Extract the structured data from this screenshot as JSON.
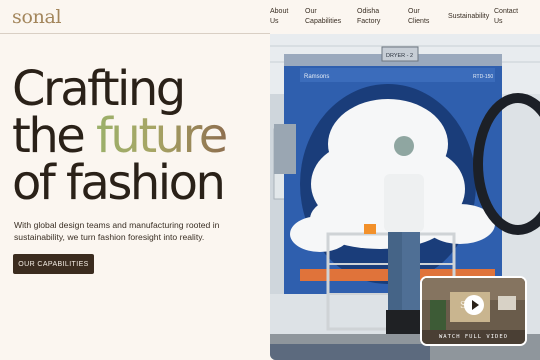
{
  "brand": {
    "logo_text": "sonal"
  },
  "nav": {
    "items": [
      {
        "line1": "About",
        "line2": "Us"
      },
      {
        "line1": "Our",
        "line2": "Capabilities"
      },
      {
        "line1": "Odisha",
        "line2": "Factory"
      },
      {
        "line1": "Our",
        "line2": "Clients"
      },
      {
        "line1": "Sustainability",
        "line2": ""
      },
      {
        "line1": "Contact",
        "line2": "Us"
      }
    ]
  },
  "hero": {
    "headline": {
      "line1": "Crafting",
      "line2_prefix": "the ",
      "line2_accent": "future",
      "line3": "of fashion"
    },
    "subtext": "With global design teams and manufacturing rooted in sustainability, we turn fashion foresight into reality.",
    "cta_label": "OUR CAPABILITIES"
  },
  "photo": {
    "machine_badge": "DRYER - 2",
    "machine_brand": "Ramsons",
    "machine_model": "RTD-150"
  },
  "video": {
    "label": "WATCH FULL VIDEO",
    "thumb_sign": "SA"
  },
  "colors": {
    "background": "#fbf6f0",
    "accent_gold": "#a3865c",
    "button_dark": "#3b2c1f",
    "headline": "#2a2118"
  }
}
